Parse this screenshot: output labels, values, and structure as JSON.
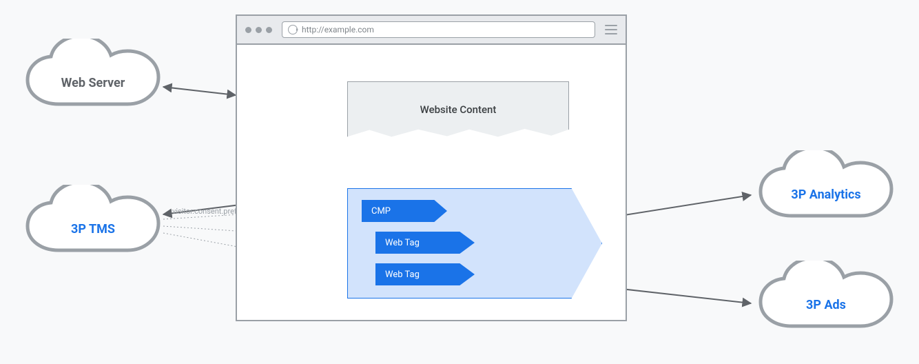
{
  "browser": {
    "url": "http://example.com",
    "content_label": "Website Content"
  },
  "tags": {
    "cmp": "CMP",
    "webtag1": "Web Tag",
    "webtag2": "Web Tag"
  },
  "clouds": {
    "web_server": "Web Server",
    "tms": "3P TMS",
    "analytics": "3P Analytics",
    "ads": "3P Ads"
  },
  "annotations": {
    "consent_line": "visitor.consent.preferences"
  },
  "colors": {
    "accent_blue": "#1a73e8",
    "light_blue": "#d2e3fc",
    "grey_line": "#9aa0a6",
    "grey_text": "#5f6368"
  }
}
